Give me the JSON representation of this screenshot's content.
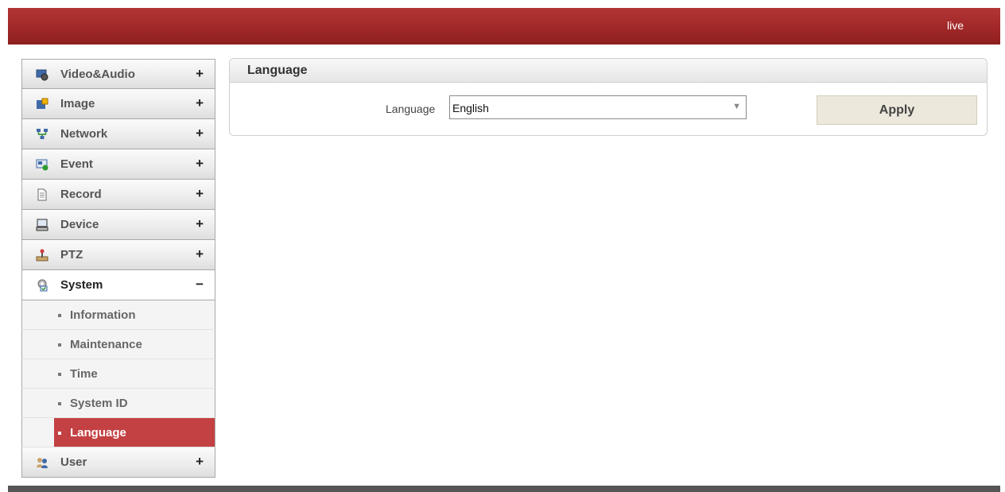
{
  "header": {
    "live_link": "live"
  },
  "sidebar": {
    "items": [
      {
        "label": "Video&Audio",
        "icon": "video-audio-icon",
        "sign": "+"
      },
      {
        "label": "Image",
        "icon": "image-icon",
        "sign": "+"
      },
      {
        "label": "Network",
        "icon": "network-icon",
        "sign": "+"
      },
      {
        "label": "Event",
        "icon": "event-icon",
        "sign": "+"
      },
      {
        "label": "Record",
        "icon": "record-icon",
        "sign": "+"
      },
      {
        "label": "Device",
        "icon": "device-icon",
        "sign": "+"
      },
      {
        "label": "PTZ",
        "icon": "ptz-icon",
        "sign": "+"
      },
      {
        "label": "System",
        "icon": "system-icon",
        "sign": "−"
      },
      {
        "label": "User",
        "icon": "user-icon",
        "sign": "+"
      }
    ],
    "system_subitems": [
      "Information",
      "Maintenance",
      "Time",
      "System ID",
      "Language"
    ],
    "active_subitem": "Language"
  },
  "panel": {
    "title": "Language",
    "field_label": "Language",
    "selected_language": "English",
    "apply_label": "Apply"
  },
  "colors": {
    "topbar": "#a12828",
    "active_item": "#c44143",
    "apply_button": "#ece8dc"
  }
}
